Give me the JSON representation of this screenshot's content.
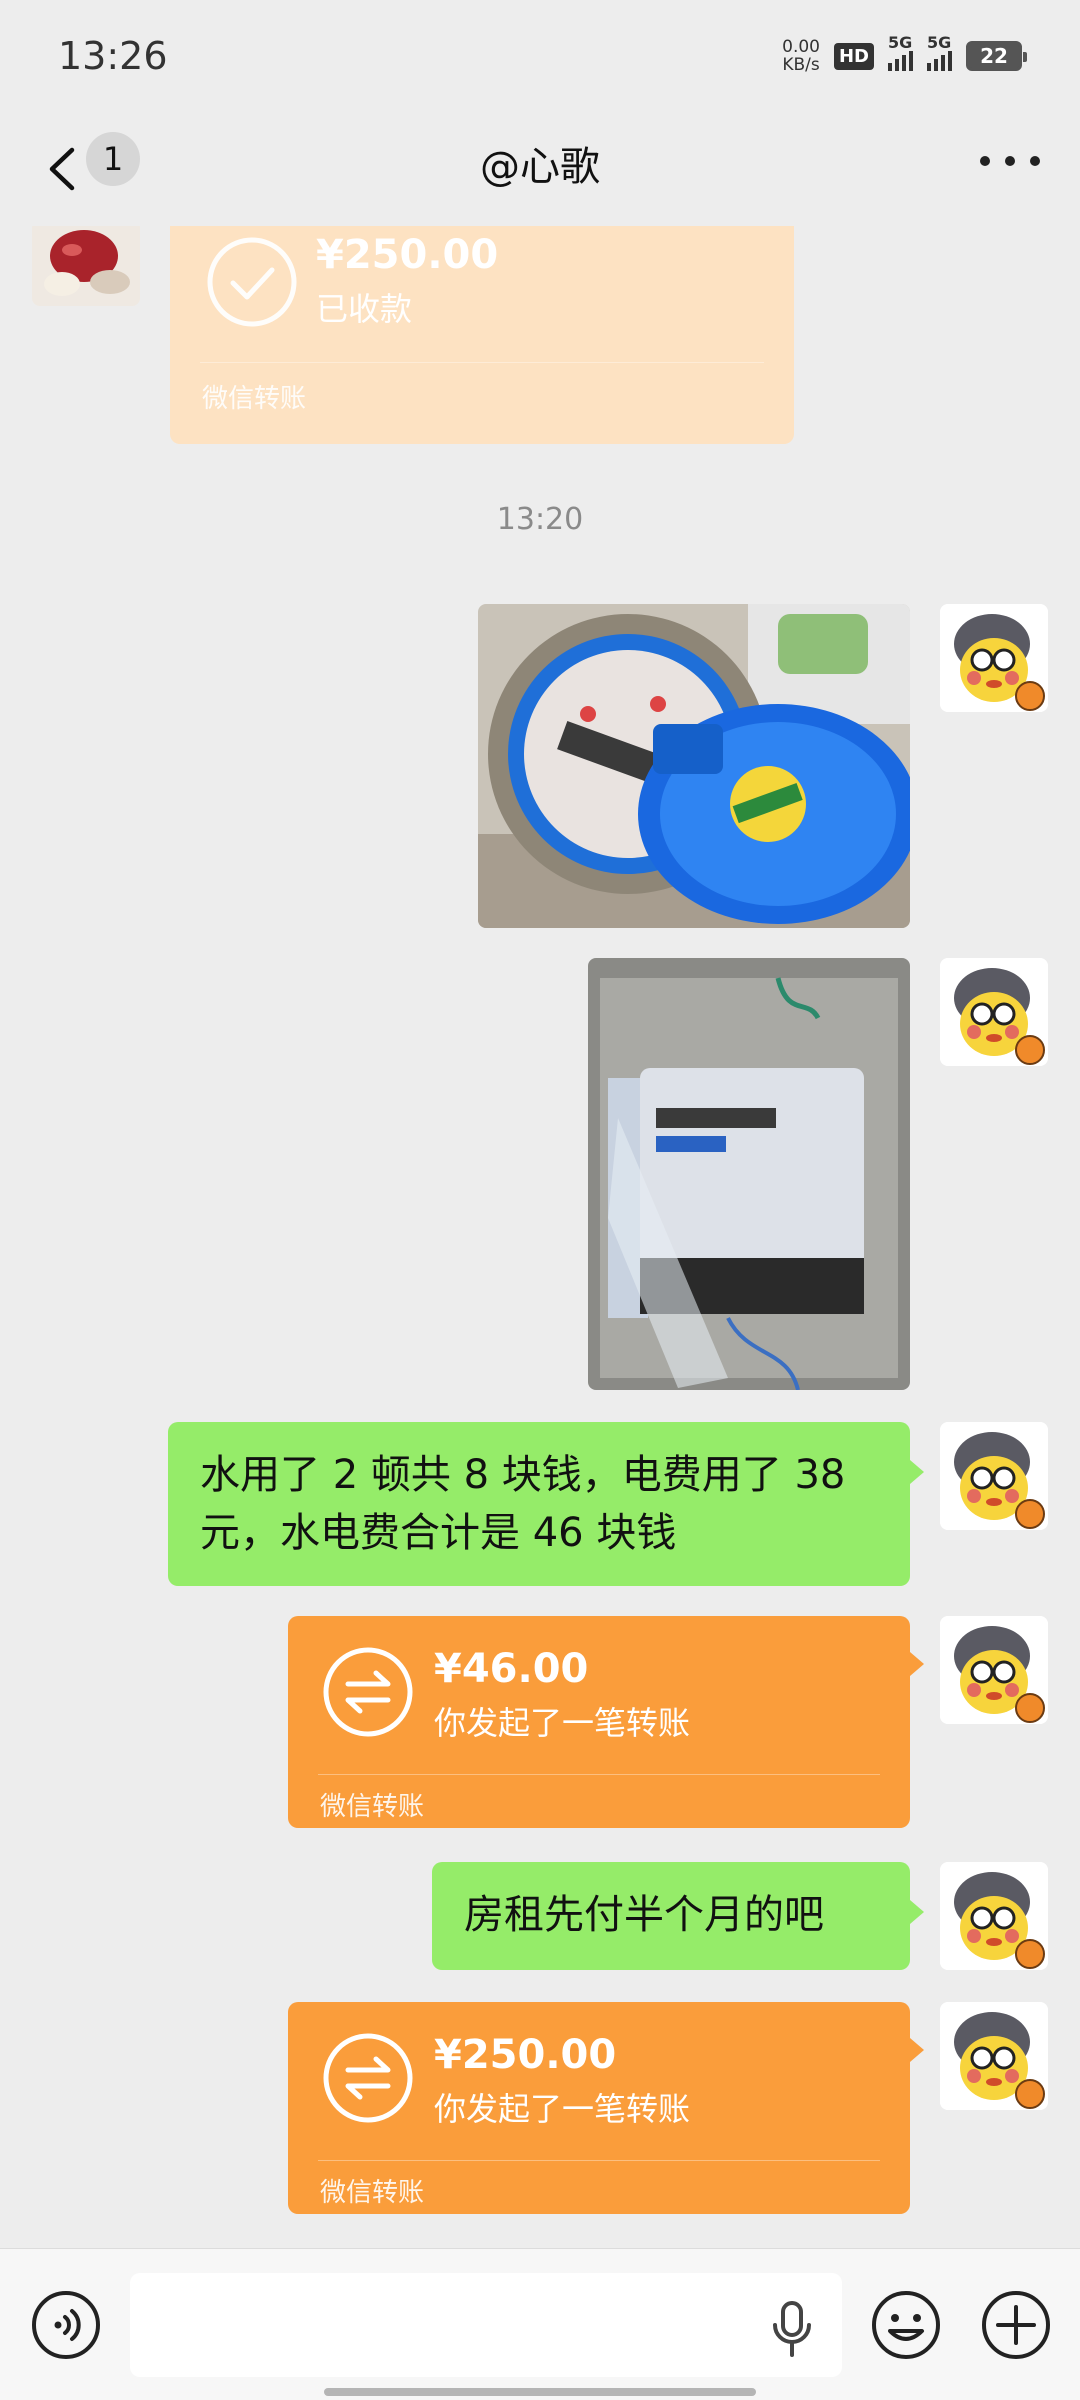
{
  "status_bar": {
    "time": "13:26",
    "net_speed_value": "0.00",
    "net_speed_unit": "KB/s",
    "hd_label": "HD",
    "sim1_label": "5G",
    "sim2_label": "5G",
    "battery_level": "22"
  },
  "nav": {
    "unread_count": "1",
    "title": "@心歌"
  },
  "messages": {
    "received_transfer": {
      "amount": "¥250.00",
      "status": "已收款",
      "footer": "微信转账"
    },
    "timestamp": "13:20",
    "text_bill": "水用了 2 顿共 8 块钱，电费用了 38 元，水电费合计是 46 块钱",
    "transfer_1": {
      "amount": "¥46.00",
      "status": "你发起了一笔转账",
      "footer": "微信转账"
    },
    "text_rent": "房租先付半个月的吧",
    "transfer_2": {
      "amount": "¥250.00",
      "status": "你发起了一笔转账",
      "footer": "微信转账"
    }
  },
  "colors": {
    "background": "#ededed",
    "my_text_bubble": "#95ec69",
    "transfer_sent": "#fa9d3b",
    "transfer_received": "#fde2c2"
  }
}
